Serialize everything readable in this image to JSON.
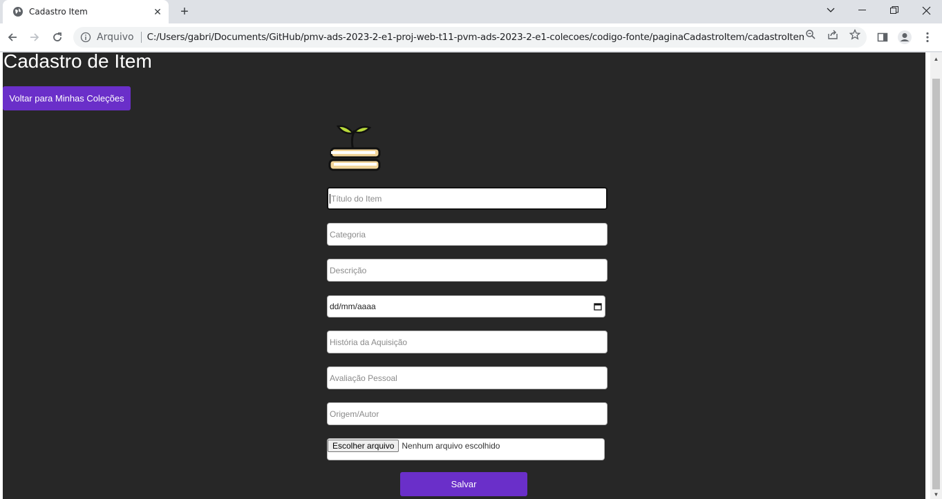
{
  "browser": {
    "tab_title": "Cadastro Item",
    "address_scheme": "Arquivo",
    "address_url": "C:/Users/gabri/Documents/GitHub/pmv-ads-2023-2-e1-proj-web-t11-pvm-ads-2023-2-e1-colecoes/codigo-fonte/paginaCadastroItem/cadastroItem.ht..."
  },
  "page": {
    "title": "Cadastro de Item",
    "back_button": "Voltar para Minhas Coleções",
    "save_button": "Salvar"
  },
  "form": {
    "titulo_placeholder": "Título do Item",
    "categoria_placeholder": "Categoria",
    "descricao_placeholder": "Descrição",
    "data_placeholder": "dd/mm/aaaa",
    "historia_placeholder": "História da Aquisição",
    "avaliacao_placeholder": "Avaliação Pessoal",
    "origem_placeholder": "Origem/Autor",
    "file_button": "Escolher arquivo",
    "file_status": "Nenhum arquivo escolhido"
  },
  "colors": {
    "accent": "#6a2fc9",
    "page_background": "#272727"
  }
}
